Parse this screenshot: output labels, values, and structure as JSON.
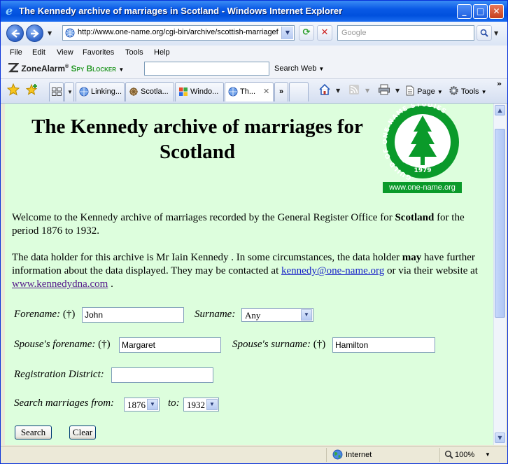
{
  "window": {
    "title": "The Kennedy archive of marriages in Scotland - Windows Internet Explorer",
    "minimize": "_",
    "maximize": "□",
    "close": "✕"
  },
  "address_bar": {
    "url": "http://www.one-name.org/cgi-bin/archive/scottish-marriagef",
    "search_placeholder": "Google"
  },
  "menu": [
    "File",
    "Edit",
    "View",
    "Favorites",
    "Tools",
    "Help"
  ],
  "zonealarm": {
    "brand": "ZoneAlarm",
    "product": "Spy Blocker",
    "search_label": "Search Web"
  },
  "tabs": [
    {
      "label": "Linking..."
    },
    {
      "label": "Scotla..."
    },
    {
      "label": "Windo..."
    },
    {
      "label": "Th..."
    }
  ],
  "tab_overflow": "»",
  "toolbar": {
    "page_label": "Page",
    "tools_label": "Tools",
    "more": "»"
  },
  "page": {
    "title": "The Kennedy archive of marriages for Scotland",
    "logo_url": "www.one-name.org",
    "logo_ring_text": "GUILD OF ONE-NAME STUDIES",
    "logo_year": "1979",
    "welcome_pre": "Welcome to the Kennedy archive of marriages recorded by the General Register Office for ",
    "welcome_bold": "Scotland",
    "welcome_post": " for the period 1876 to 1932.",
    "holder_pre": "The data holder for this archive is Mr Iain Kennedy . In some circumstances, the data holder ",
    "holder_bold": "may",
    "holder_mid": " have further information about the data displayed. They may be contacted at ",
    "email": "kennedy@one-name.org",
    "holder_mid2": " or via their website at ",
    "website": "www.kennedydna.com",
    "holder_end": " ."
  },
  "form": {
    "forename_label": "Forename:",
    "forename_value": "John",
    "surname_label": "Surname:",
    "surname_value": "Any",
    "spouse_forename_label": "Spouse's forename:",
    "spouse_forename_value": "Margaret",
    "spouse_surname_label": "Spouse's surname:",
    "spouse_surname_value": "Hamilton",
    "district_label": "Registration District:",
    "district_value": "",
    "from_label": "Search marriages from:",
    "from_value": "1876",
    "to_label": "to:",
    "to_value": "1932",
    "dagger": "(†)",
    "search_button": "Search",
    "clear_button": "Clear"
  },
  "status": {
    "zone": "Internet",
    "zoom": "100%"
  },
  "colors": {
    "page_background": "#ddfedd",
    "logo_green": "#0a9a2a",
    "link": "#1a24c8"
  }
}
